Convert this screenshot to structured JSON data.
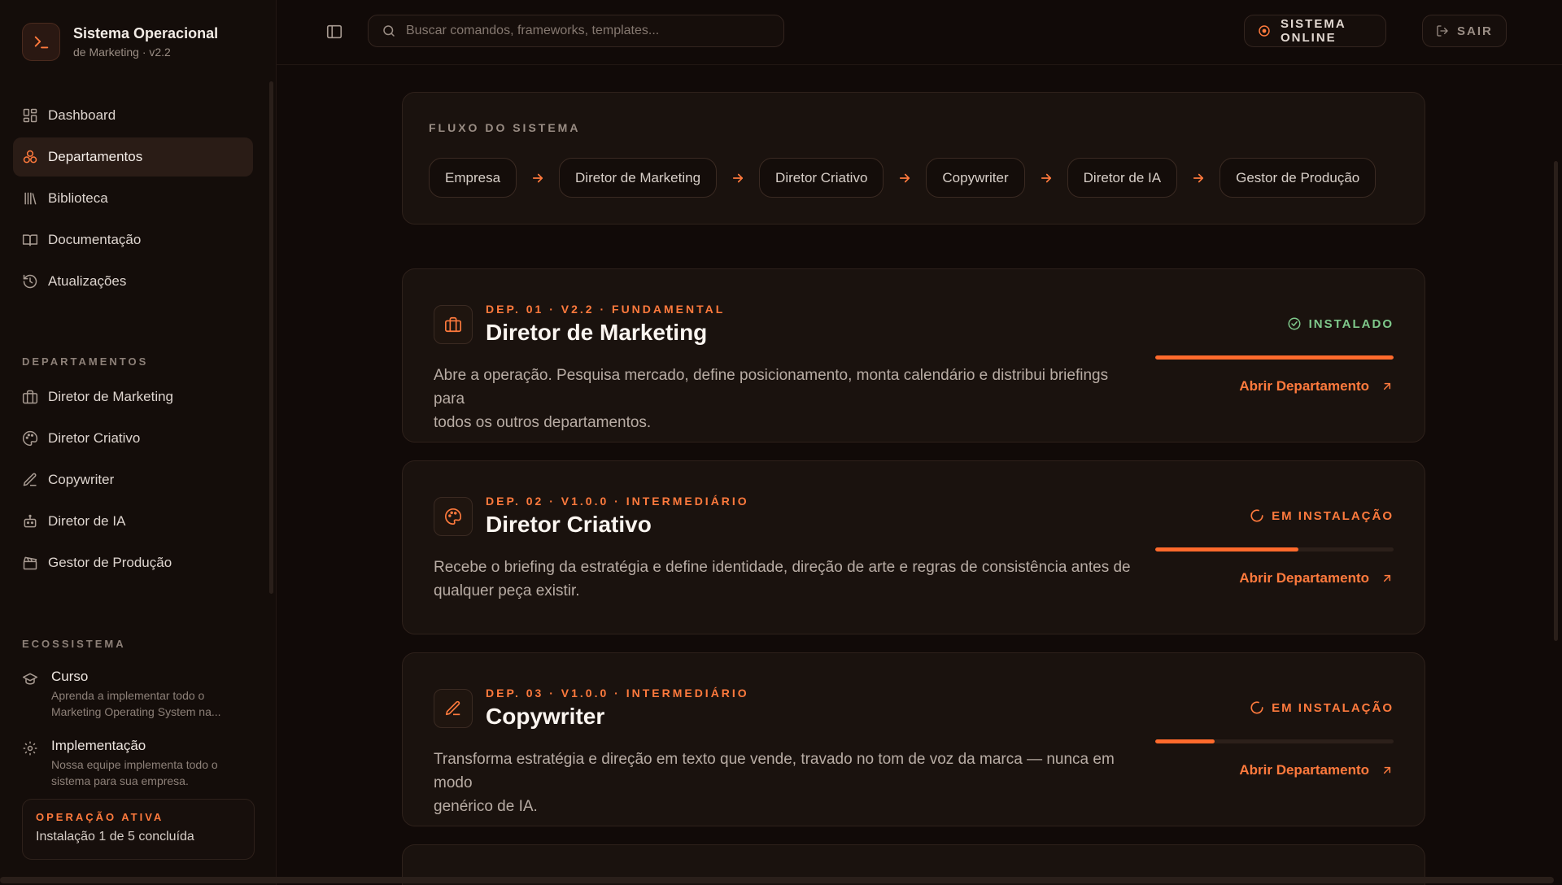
{
  "brand": {
    "title": "Sistema Operacional",
    "subtitle": "de Marketing · v2.2",
    "logo_icon": "terminal-icon"
  },
  "nav": {
    "items": [
      {
        "label": "Dashboard",
        "icon": "grid-icon"
      },
      {
        "label": "Departamentos",
        "icon": "nodes-icon",
        "active": true
      },
      {
        "label": "Biblioteca",
        "icon": "library-icon"
      },
      {
        "label": "Documentação",
        "icon": "book-icon"
      },
      {
        "label": "Atualizações",
        "icon": "history-icon"
      }
    ]
  },
  "departments_section": {
    "label": "DEPARTAMENTOS",
    "items": [
      {
        "label": "Diretor de Marketing",
        "icon": "briefcase-icon"
      },
      {
        "label": "Diretor Criativo",
        "icon": "palette-icon"
      },
      {
        "label": "Copywriter",
        "icon": "pen-icon"
      },
      {
        "label": "Diretor de IA",
        "icon": "robot-icon"
      },
      {
        "label": "Gestor de Produção",
        "icon": "clapperboard-icon"
      }
    ]
  },
  "ecosystem": {
    "label": "ECOSSISTEMA",
    "items": [
      {
        "title": "Curso",
        "desc_line1": "Aprenda a implementar todo o",
        "desc_line2": "Marketing Operating System na...",
        "icon": "graduation-cap-icon"
      },
      {
        "title": "Implementação",
        "desc_line1": "Nossa equipe implementa todo o",
        "desc_line2": "sistema para sua empresa.",
        "icon": "gear-icon"
      }
    ]
  },
  "operation": {
    "label": "OPERAÇÃO ATIVA",
    "text": "Instalação 1 de 5 concluída"
  },
  "header": {
    "search_placeholder": "Buscar comandos, frameworks, templates...",
    "status_label": "SISTEMA ONLINE",
    "exit_label": "SAIR"
  },
  "flow": {
    "label": "FLUXO DO SISTEMA",
    "steps": [
      "Empresa",
      "Diretor de Marketing",
      "Diretor Criativo",
      "Copywriter",
      "Diretor de IA",
      "Gestor de Produção"
    ]
  },
  "departments": [
    {
      "meta": "DEP. 01 · V2.2 · FUNDAMENTAL",
      "title": "Diretor de Marketing",
      "desc_line1": "Abre a operação. Pesquisa mercado, define posicionamento, monta calendário e distribui briefings para",
      "desc_line2": "todos os outros departamentos.",
      "status": "INSTALADO",
      "status_type": "installed",
      "progress": 1.0,
      "link": "Abrir Departamento",
      "icon": "briefcase-icon"
    },
    {
      "meta": "DEP. 02 · V1.0.0 · INTERMEDIÁRIO",
      "title": "Diretor Criativo",
      "desc_line1": "Recebe o briefing da estratégia e define identidade, direção de arte e regras de consistência antes de",
      "desc_line2": "qualquer peça existir.",
      "status": "EM INSTALAÇÃO",
      "status_type": "installing",
      "progress": 0.6,
      "link": "Abrir Departamento",
      "icon": "palette-icon"
    },
    {
      "meta": "DEP. 03 · V1.0.0 · INTERMEDIÁRIO",
      "title": "Copywriter",
      "desc_line1": "Transforma estratégia e direção em texto que vende, travado no tom de voz da marca — nunca em modo",
      "desc_line2": "genérico de IA.",
      "status": "EM INSTALAÇÃO",
      "status_type": "installing",
      "progress": 0.25,
      "link": "Abrir Departamento",
      "icon": "pen-icon"
    }
  ],
  "colors": {
    "accent": "#ff7a3d",
    "success": "#7fc98b",
    "background": "#110a08",
    "card": "#1a120e"
  }
}
